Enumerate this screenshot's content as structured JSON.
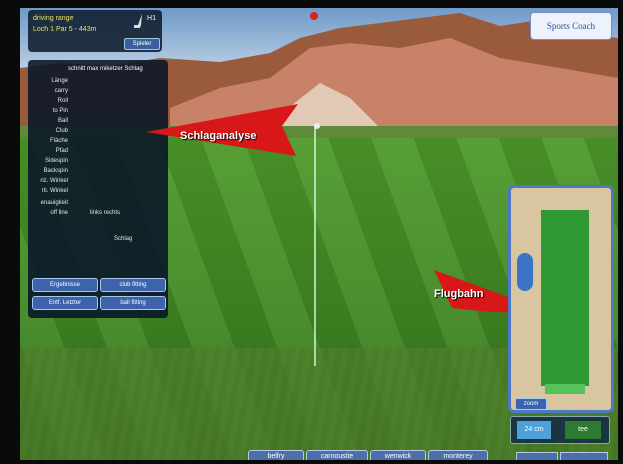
{
  "hole": {
    "line1": "driving range",
    "line2": "Loch 1 Par 5 - 443m",
    "hole_number": "H1",
    "player_button": "Spieler"
  },
  "logo": {
    "text": "Sports Coach"
  },
  "analysis": {
    "header": "schnitt max   miketzer Schlag",
    "rows": [
      "Länge",
      "carry",
      "Roll",
      "to Pin",
      "Ball",
      "Club",
      "Fläche",
      "Pfad",
      "Sidespin",
      "Backspin",
      "riz. Winkel",
      "rti. Winkel",
      "enauigkeit",
      "off line"
    ],
    "accuracy_values": "links rechts",
    "shot_label": "Schlag",
    "buttons": {
      "results": "Ergebnisse",
      "club_fitting": "club fitting",
      "delete_last": "Entf. Letzter",
      "ball_fitting": "ball fitting"
    }
  },
  "callouts": {
    "shot_analysis": "Schlaganalyse",
    "flight_path": "Flugbahn"
  },
  "minimap": {
    "zoom_button": "zoom"
  },
  "wind": {
    "distance": "24 cm",
    "tee": "tee"
  },
  "course_tabs": [
    "belfry",
    "carnoustie",
    "wenwick",
    "monterey"
  ],
  "colors": {
    "arrow": "#d81818",
    "panel": "#0a1a2e",
    "button": "#3d63aa"
  }
}
